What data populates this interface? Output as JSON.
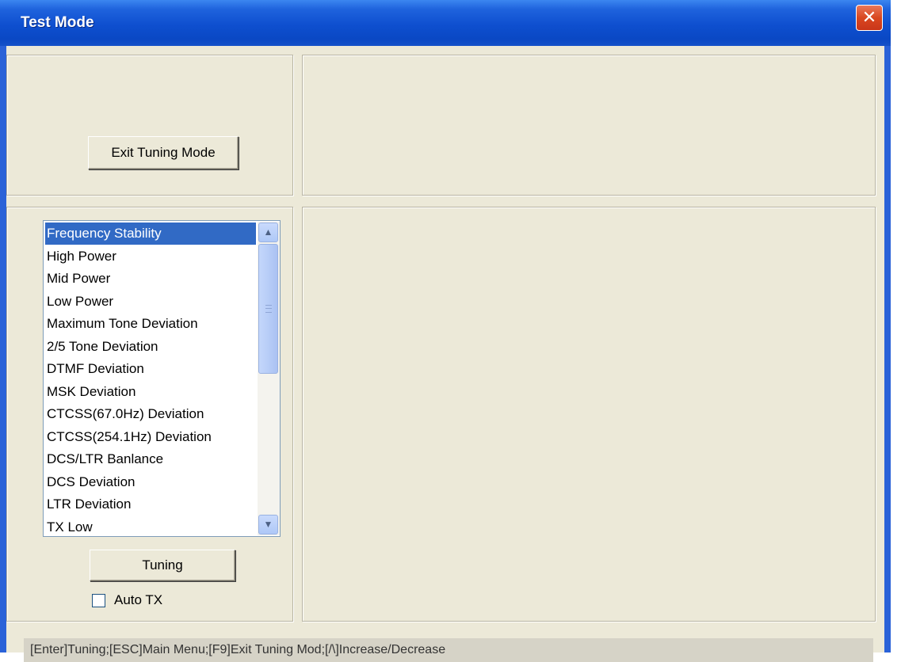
{
  "window": {
    "title": "Test Mode",
    "close_glyph": "✕"
  },
  "buttons": {
    "exit_tuning": "Exit Tuning Mode",
    "tuning": "Tuning"
  },
  "list": {
    "selected_index": 0,
    "items": [
      "Frequency Stability",
      "High Power",
      "Mid Power",
      "Low Power",
      "Maximum Tone Deviation",
      "2/5 Tone Deviation",
      "DTMF Deviation",
      "MSK Deviation",
      "CTCSS(67.0Hz) Deviation",
      "CTCSS(254.1Hz) Deviation",
      "DCS/LTR Banlance",
      "DCS Deviation",
      "LTR Deviation",
      "TX Low"
    ],
    "scroll_up_icon": "▲",
    "scroll_down_icon": "▼"
  },
  "auto_tx": {
    "label": "Auto TX",
    "checked": false
  },
  "status": {
    "text": "[Enter]Tuning;[ESC]Main Menu;[F9]Exit Tuning Mod;[/\\]Increase/Decrease"
  },
  "colors": {
    "title_bar": "#0a48c4",
    "selection": "#316ac5",
    "face": "#ece9d8"
  }
}
